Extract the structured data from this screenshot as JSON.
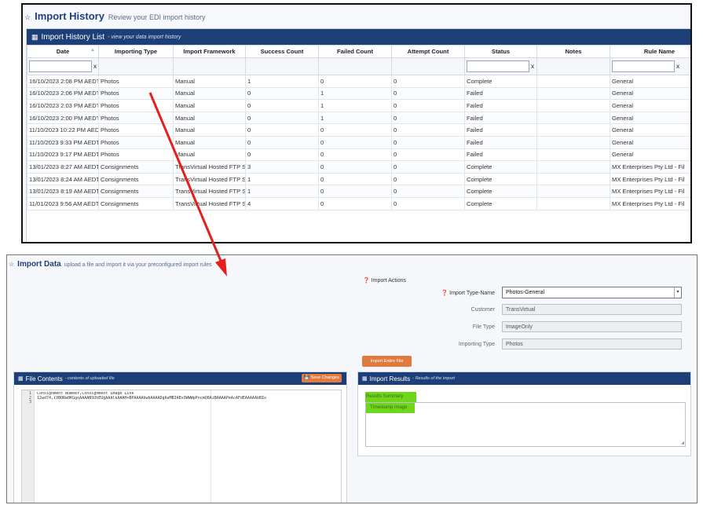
{
  "history": {
    "title": "Import History",
    "subtitle": "Review your EDI import history",
    "panel_title": "Import History List",
    "panel_subtitle": "- view your data import history",
    "columns": [
      "Date",
      "Importing Type",
      "Import Framework",
      "Success Count",
      "Failed Count",
      "Attempt Count",
      "Status",
      "Notes",
      "Rule Name"
    ],
    "filter_clear": "x",
    "rows": [
      [
        "16/10/2023 2:08 PM AEDT",
        "Photos",
        "Manual",
        "1",
        "0",
        "0",
        "Complete",
        "",
        "General"
      ],
      [
        "16/10/2023 2:06 PM AEDT",
        "Photos",
        "Manual",
        "0",
        "1",
        "0",
        "Failed",
        "",
        "General"
      ],
      [
        "16/10/2023 2:03 PM AEDT",
        "Photos",
        "Manual",
        "0",
        "1",
        "0",
        "Failed",
        "",
        "General"
      ],
      [
        "16/10/2023 2:00 PM AEDT",
        "Photos",
        "Manual",
        "0",
        "1",
        "0",
        "Failed",
        "",
        "General"
      ],
      [
        "11/10/2023 10:22 PM AEDT",
        "Photos",
        "Manual",
        "0",
        "0",
        "0",
        "Failed",
        "",
        "General"
      ],
      [
        "11/10/2023 9:33 PM AEDT",
        "Photos",
        "Manual",
        "0",
        "0",
        "0",
        "Failed",
        "",
        "General"
      ],
      [
        "11/10/2023 9:17 PM AEDT",
        "Photos",
        "Manual",
        "0",
        "0",
        "0",
        "Failed",
        "",
        "General"
      ],
      [
        "13/01/2023 8:27 AM AEDT",
        "Consignments",
        "TransVirtual Hosted FTP Se",
        "3",
        "0",
        "0",
        "Complete",
        "",
        "MX Enterprises Pty Ltd - Fil"
      ],
      [
        "13/01/2023 8:24 AM AEDT",
        "Consignments",
        "TransVirtual Hosted FTP Se",
        "1",
        "0",
        "0",
        "Complete",
        "",
        "MX Enterprises Pty Ltd - Fil"
      ],
      [
        "13/01/2023 8:19 AM AEDT",
        "Consignments",
        "TransVirtual Hosted FTP Se",
        "1",
        "0",
        "0",
        "Complete",
        "",
        "MX Enterprises Pty Ltd - Fil"
      ],
      [
        "11/01/2023 9:56 AM AEDT",
        "Consignments",
        "TransVirtual Hosted FTP Se",
        "4",
        "0",
        "0",
        "Complete",
        "",
        "MX Enterprises Pty Ltd - Fil"
      ]
    ]
  },
  "import_data": {
    "title": "Import Data",
    "subtitle": "upload a file and import it via your preconfigured import rules",
    "actions_title": "Import Actions",
    "fields": {
      "type_name_label": "Import Type-Name",
      "type_name_value": "Photos-General",
      "customer_label": "Customer",
      "customer_value": "TransVirtual",
      "file_type_label": "File Type",
      "file_type_value": "ImageOnly",
      "importing_type_label": "Importing Type",
      "importing_type_value": "Photos"
    },
    "import_button": "Import Entire File",
    "file_contents": {
      "title": "File Contents",
      "subtitle": "- contents of uploaded file",
      "save_button": "Save Changes",
      "line_numbers": [
        "1",
        "2",
        "3"
      ],
      "code": "Consignment Number,Consignment Image Link\n12wd74,iVBORw0KGgoAAAANSUhEUgAAAlkAAAH+BPAAAAbwbAAAADgAeMBIAEsOWWWpPncmQ8AiBAAAAPeAcAFdEAAAAAbBIo\n"
    },
    "results": {
      "title": "Import Results",
      "subtitle": "- Results of the import",
      "summary_label": "Results Summary",
      "message": "Timestamp image"
    }
  },
  "colors": {
    "header_blue": "#1c3f77",
    "orange_button": "#e07a3d",
    "highlight_green": "#6fd61b",
    "arrow_red": "#e3201b"
  }
}
